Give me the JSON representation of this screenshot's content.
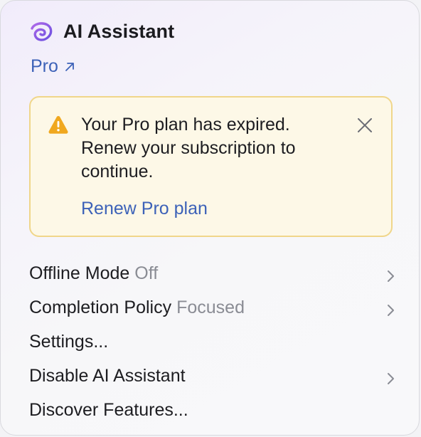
{
  "header": {
    "title": "AI Assistant",
    "logo_icon": "swirl-logo-icon",
    "accent_color": "#8a55e0"
  },
  "plan": {
    "label": "Pro",
    "link_icon": "external-arrow-icon",
    "link_color": "#3d62b8"
  },
  "banner": {
    "icon": "warning-triangle-icon",
    "message": "Your Pro plan has expired. Renew your subscription to continue.",
    "action_label": "Renew Pro plan",
    "close_icon": "close-icon",
    "background_color": "#fdf8e7",
    "border_color": "#f0d68a",
    "warning_color": "#f0a81f"
  },
  "menu": {
    "items": [
      {
        "label": "Offline Mode",
        "value": "Off",
        "has_submenu": true
      },
      {
        "label": "Completion Policy",
        "value": "Focused",
        "has_submenu": true
      },
      {
        "label": "Settings...",
        "value": "",
        "has_submenu": false
      },
      {
        "label": "Disable AI Assistant",
        "value": "",
        "has_submenu": true
      },
      {
        "label": "Discover Features...",
        "value": "",
        "has_submenu": false
      }
    ],
    "value_color": "#8a8c94"
  }
}
